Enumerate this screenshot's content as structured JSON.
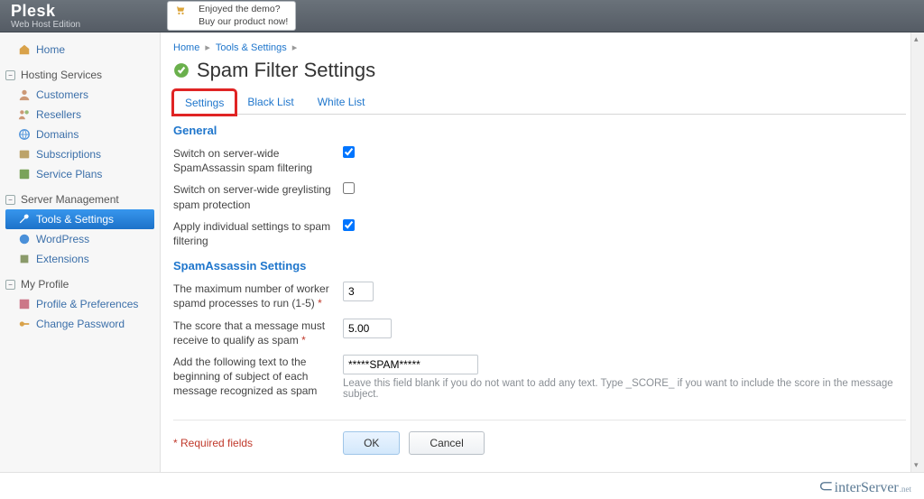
{
  "brand": {
    "title": "Plesk",
    "subtitle": "Web Host Edition"
  },
  "demo": {
    "line1": "Enjoyed the demo?",
    "line2": "Buy our product now!"
  },
  "sidebar": {
    "home": "Home",
    "groups": {
      "hosting": "Hosting Services",
      "server": "Server Management",
      "profile": "My Profile"
    },
    "items": {
      "customers": "Customers",
      "resellers": "Resellers",
      "domains": "Domains",
      "subscriptions": "Subscriptions",
      "service_plans": "Service Plans",
      "tools_settings": "Tools & Settings",
      "wordpress": "WordPress",
      "extensions": "Extensions",
      "profile_prefs": "Profile & Preferences",
      "change_password": "Change Password"
    }
  },
  "breadcrumbs": {
    "home": "Home",
    "tools": "Tools & Settings"
  },
  "page": {
    "title": "Spam Filter Settings"
  },
  "tabs": {
    "settings": "Settings",
    "blacklist": "Black List",
    "whitelist": "White List"
  },
  "sections": {
    "general": "General",
    "sa": "SpamAssassin Settings"
  },
  "fields": {
    "serverwide": {
      "label": "Switch on server-wide SpamAssassin spam filtering",
      "checked": true
    },
    "greylist": {
      "label": "Switch on server-wide greylisting spam protection",
      "checked": false
    },
    "individual": {
      "label": "Apply individual settings to spam filtering",
      "checked": true
    },
    "workers": {
      "label": "The maximum number of worker spamd processes to run (1-5)",
      "value": "3"
    },
    "score": {
      "label": "The score that a message must receive to qualify as spam",
      "value": "5.00"
    },
    "subject": {
      "label": "Add the following text to the beginning of subject of each message recognized as spam",
      "value": "*****SPAM*****",
      "hint": "Leave this field blank if you do not want to add any text. Type _SCORE_ if you want to include the score in the message subject."
    }
  },
  "required_note": "* Required fields",
  "buttons": {
    "ok": "OK",
    "cancel": "Cancel"
  },
  "footer": {
    "brand": "interServer",
    "suffix": ".net"
  }
}
